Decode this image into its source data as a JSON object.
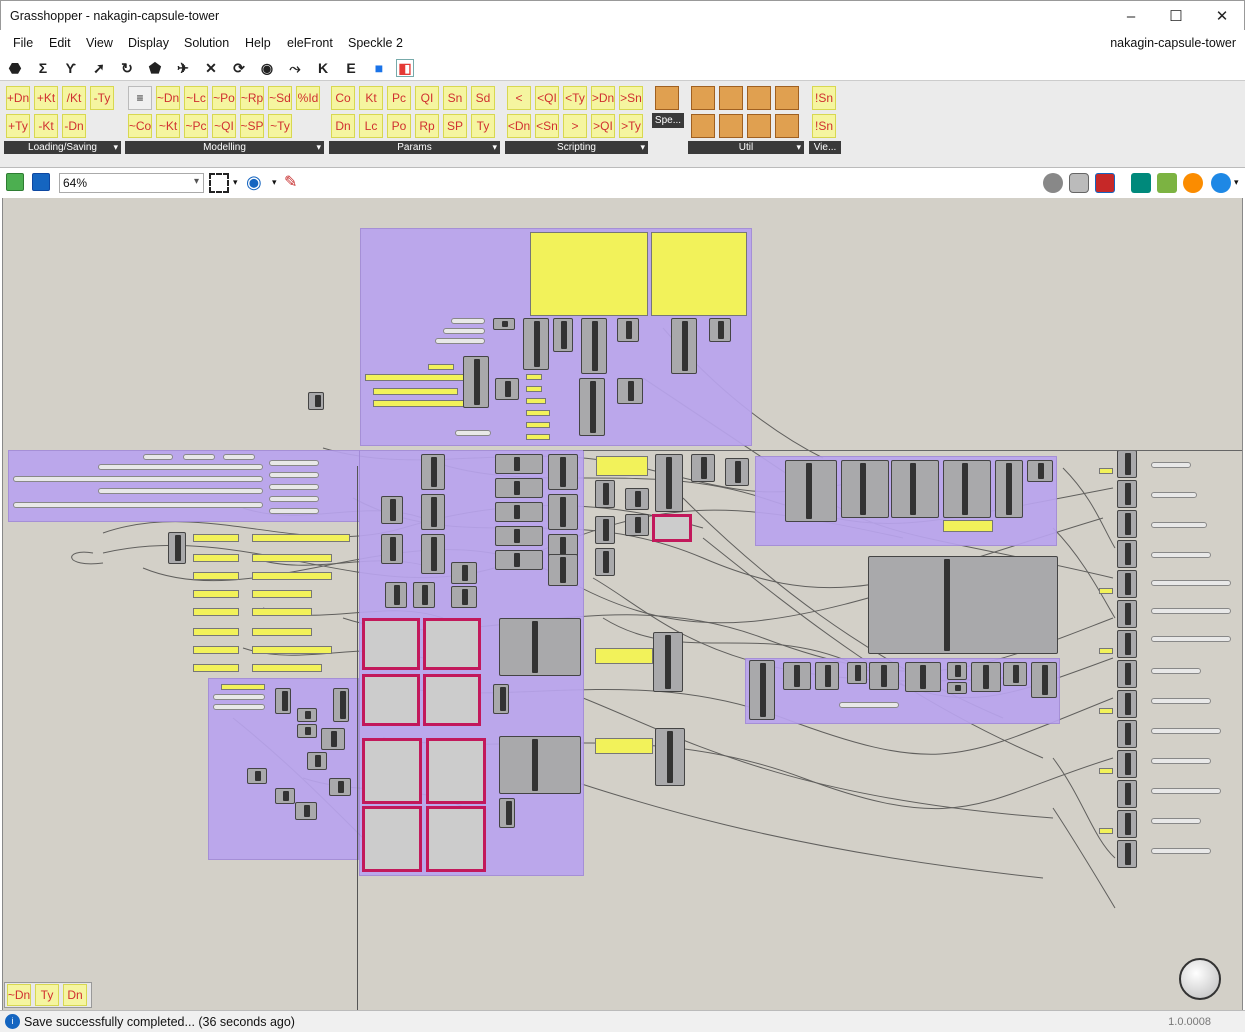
{
  "window": {
    "title": "Grasshopper - nakagin-capsule-tower",
    "min": "–",
    "max": "☐",
    "close": "✕"
  },
  "menu": {
    "items": [
      "File",
      "Edit",
      "View",
      "Display",
      "Solution",
      "Help",
      "eleFront",
      "Speckle 2"
    ],
    "doc_name": "nakagin-capsule-tower"
  },
  "tabs": {
    "glyphs": [
      "⬣",
      "Σ",
      "Ƴ",
      "➚",
      "↻",
      "⬟",
      "✈",
      "✕",
      "⟳",
      "◉",
      "⤳",
      "K",
      "E",
      "■",
      "◧"
    ]
  },
  "ribbon": {
    "loading": {
      "label": "Loading/Saving",
      "row1": [
        "+Dn",
        "+Kt",
        "/Kt",
        "-Ty"
      ],
      "row2": [
        "+Ty",
        "-Kt",
        "-Dn"
      ]
    },
    "modelling": {
      "label": "Modelling",
      "row1": [
        "≡",
        "~Dn",
        "~Lc",
        "~Po",
        "~Rp",
        "~Sd",
        "%Id"
      ],
      "row2": [
        "~Co",
        "~Kt",
        "~Pc",
        "~QI",
        "~SP",
        "~Ty"
      ]
    },
    "params": {
      "label": "Params",
      "row1": [
        "Co",
        "Kt",
        "Pc",
        "QI",
        "Sn",
        "Sd"
      ],
      "row2": [
        "Dn",
        "Lc",
        "Po",
        "Rp",
        "SP",
        "Ty"
      ]
    },
    "scripting": {
      "label": "Scripting",
      "row1": [
        "<",
        "<QI",
        "<Ty",
        ">Dn",
        ">Sn"
      ],
      "row2": [
        "<Dn",
        "<Sn",
        ">",
        ">QI",
        ">Ty"
      ]
    },
    "spe": {
      "label": "Spe..."
    },
    "util": {
      "label": "Util"
    },
    "vie": {
      "label": "Vie...",
      "row1": [
        "!Sn"
      ],
      "row2": [
        "!Sn"
      ]
    }
  },
  "toolbar": {
    "zoom": "64%"
  },
  "status": {
    "message": "Save successfully completed... (36 seconds ago)",
    "version": "1.0.0008"
  },
  "preview": {
    "items": [
      "~Dn",
      "Ty",
      "Dn"
    ]
  }
}
